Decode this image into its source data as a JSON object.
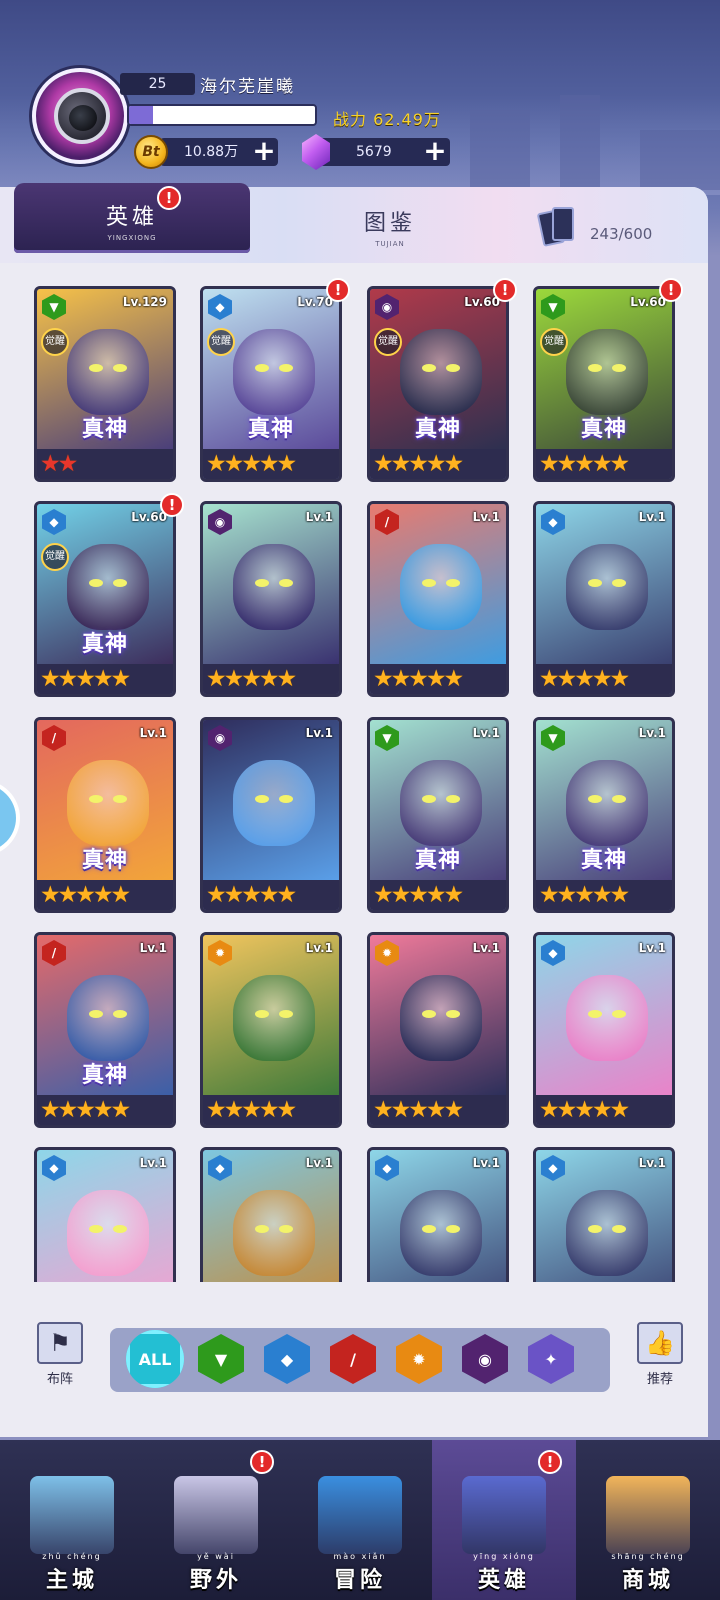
{
  "player": {
    "level": "25",
    "name": "海尔芜崖曦",
    "exp_fraction": 0.13,
    "power_label": "战力",
    "power_value": "62.49万",
    "coins": "10.88万",
    "gems": "5679",
    "coin_symbol": "Bt",
    "plus": "+"
  },
  "tabs": {
    "heroes": {
      "label": "英雄",
      "pinyin": "YINGXIONG",
      "badge": "!"
    },
    "codex": {
      "label": "图鉴",
      "pinyin": "TUJIAN"
    },
    "collection": "243/600"
  },
  "heroes": [
    {
      "level": "Lv.129",
      "faction": "green",
      "stars": "★★",
      "star_color": "red",
      "awaken": "觉醒",
      "god": "真神",
      "badge": false,
      "palette": [
        "#f7c248",
        "#4a3f7a"
      ]
    },
    {
      "level": "Lv.70",
      "faction": "blue",
      "stars": "★★★★★",
      "star_color": "gold",
      "awaken": "觉醒",
      "god": "真神",
      "badge": true,
      "palette": [
        "#bfe1f0",
        "#5b4a9a"
      ]
    },
    {
      "level": "Lv.60",
      "faction": "purple",
      "stars": "★★★★★",
      "star_color": "gold",
      "awaken": "觉醒",
      "god": "真神",
      "badge": true,
      "palette": [
        "#b13a4a",
        "#2d3050"
      ]
    },
    {
      "level": "Lv.60",
      "faction": "green",
      "stars": "★★★★★",
      "star_color": "gold",
      "awaken": "觉醒",
      "god": "真神",
      "badge": true,
      "palette": [
        "#9cd93b",
        "#3d4a3a"
      ]
    },
    {
      "level": "Lv.60",
      "faction": "blue",
      "stars": "★★★★★",
      "star_color": "gold",
      "awaken": "觉醒",
      "god": "真神",
      "badge": true,
      "palette": [
        "#72d2e8",
        "#3d2d5c"
      ]
    },
    {
      "level": "Lv.1",
      "faction": "purple",
      "stars": "★★★★★",
      "star_color": "gold",
      "awaken": "",
      "god": "",
      "badge": false,
      "palette": [
        "#a7e3cf",
        "#3a3270"
      ]
    },
    {
      "level": "Lv.1",
      "faction": "red",
      "stars": "★★★★★",
      "star_color": "gold",
      "awaken": "",
      "god": "",
      "badge": false,
      "palette": [
        "#e97b6f",
        "#3f9ce0"
      ]
    },
    {
      "level": "Lv.1",
      "faction": "blue",
      "stars": "★★★★★",
      "star_color": "gold",
      "awaken": "",
      "god": "",
      "badge": false,
      "palette": [
        "#8ed6e8",
        "#3a4070"
      ]
    },
    {
      "level": "Lv.1",
      "faction": "red",
      "stars": "★★★★★",
      "star_color": "gold",
      "awaken": "",
      "god": "真神",
      "badge": false,
      "palette": [
        "#e3685e",
        "#f2a53a"
      ]
    },
    {
      "level": "Lv.1",
      "faction": "purple",
      "stars": "★★★★★",
      "star_color": "gold",
      "awaken": "",
      "god": "",
      "badge": false,
      "palette": [
        "#2f2d5c",
        "#5a9fe8"
      ]
    },
    {
      "level": "Lv.1",
      "faction": "green",
      "stars": "★★★★★",
      "star_color": "gold",
      "awaken": "",
      "god": "真神",
      "badge": false,
      "palette": [
        "#a3e1d0",
        "#4a3f7a"
      ]
    },
    {
      "level": "Lv.1",
      "faction": "green",
      "stars": "★★★★★",
      "star_color": "gold",
      "awaken": "",
      "god": "真神",
      "badge": false,
      "palette": [
        "#a3e1d0",
        "#4a3f7a"
      ]
    },
    {
      "level": "Lv.1",
      "faction": "red",
      "stars": "★★★★★",
      "star_color": "gold",
      "awaken": "",
      "god": "真神",
      "badge": false,
      "palette": [
        "#e56a6a",
        "#3b5fa8"
      ]
    },
    {
      "level": "Lv.1",
      "faction": "orange",
      "stars": "★★★★★",
      "star_color": "gold",
      "awaken": "",
      "god": "",
      "badge": false,
      "palette": [
        "#f2c55e",
        "#3e7a3a"
      ]
    },
    {
      "level": "Lv.1",
      "faction": "orange",
      "stars": "★★★★★",
      "star_color": "gold",
      "awaken": "",
      "god": "",
      "badge": false,
      "palette": [
        "#f07a9a",
        "#2c2f5a"
      ]
    },
    {
      "level": "Lv.1",
      "faction": "blue",
      "stars": "★★★★★",
      "star_color": "gold",
      "awaken": "",
      "god": "",
      "badge": false,
      "palette": [
        "#8ed6e8",
        "#e983c9"
      ]
    },
    {
      "level": "Lv.1",
      "faction": "blue",
      "stars": "",
      "star_color": "gold",
      "awaken": "",
      "god": "",
      "badge": false,
      "palette": [
        "#8ed6e8",
        "#f3a1d0"
      ]
    },
    {
      "level": "Lv.1",
      "faction": "blue",
      "stars": "",
      "star_color": "gold",
      "awaken": "",
      "god": "",
      "badge": false,
      "palette": [
        "#7ec7e0",
        "#c58a3a"
      ]
    },
    {
      "level": "Lv.1",
      "faction": "blue",
      "stars": "",
      "star_color": "gold",
      "awaken": "",
      "god": "",
      "badge": false,
      "palette": [
        "#8ed6e8",
        "#3a4070"
      ]
    },
    {
      "level": "Lv.1",
      "faction": "blue",
      "stars": "",
      "star_color": "gold",
      "awaken": "",
      "god": "",
      "badge": false,
      "palette": [
        "#8ed6e8",
        "#3a4070"
      ]
    }
  ],
  "filters": {
    "left_button": "布阵",
    "right_button": "推荐",
    "items": [
      {
        "id": "all",
        "label": "ALL"
      },
      {
        "id": "green",
        "label": ""
      },
      {
        "id": "blue",
        "label": ""
      },
      {
        "id": "red",
        "label": ""
      },
      {
        "id": "orange",
        "label": ""
      },
      {
        "id": "purple",
        "label": ""
      },
      {
        "id": "lavender",
        "label": ""
      }
    ]
  },
  "nav": [
    {
      "label": "主城",
      "pinyin": "zhǔ chéng",
      "badge": false,
      "active": false
    },
    {
      "label": "野外",
      "pinyin": "yě wài",
      "badge": true,
      "active": false
    },
    {
      "label": "冒险",
      "pinyin": "mào xiǎn",
      "badge": false,
      "active": false
    },
    {
      "label": "英雄",
      "pinyin": "yīng xióng",
      "badge": true,
      "active": true
    },
    {
      "label": "商城",
      "pinyin": "shāng chéng",
      "badge": false,
      "active": false
    }
  ],
  "colors": {
    "accent_purple": "#2b2250",
    "badge_red": "#e32a2a",
    "star_gold": "#ffb21f",
    "power_yellow": "#f6d22c"
  }
}
